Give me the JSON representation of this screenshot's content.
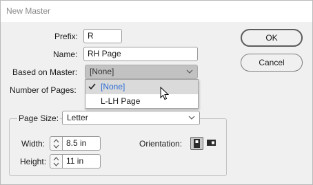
{
  "window": {
    "title": "New Master"
  },
  "form": {
    "prefix": {
      "label": "Prefix:",
      "value": "R"
    },
    "name": {
      "label": "Name:",
      "value": "RH Page"
    },
    "based_on": {
      "label": "Based on Master:",
      "value": "[None]"
    },
    "num_pages": {
      "label": "Number of Pages:"
    }
  },
  "dropdown": {
    "options": [
      {
        "label": "[None]",
        "selected": true
      },
      {
        "label": "L-LH Page",
        "selected": false
      }
    ]
  },
  "page_size": {
    "label": "Page Size:",
    "value": "Letter",
    "width": {
      "label": "Width:",
      "value": "8.5 in"
    },
    "height": {
      "label": "Height:",
      "value": "11 in"
    },
    "orientation": {
      "label": "Orientation:",
      "selected": "portrait"
    }
  },
  "buttons": {
    "ok": "OK",
    "cancel": "Cancel"
  },
  "icons": {
    "check": "checkmark-icon",
    "chevron": "chevron-down-icon",
    "stepper": "stepper-arrows-icon",
    "portrait": "portrait-orientation-icon",
    "landscape": "landscape-orientation-icon",
    "cursor": "mouse-pointer-icon"
  },
  "colors": {
    "selected_text": "#2c6dd6",
    "active_select": "#c2c2c2",
    "menu_highlight": "#dadada"
  }
}
